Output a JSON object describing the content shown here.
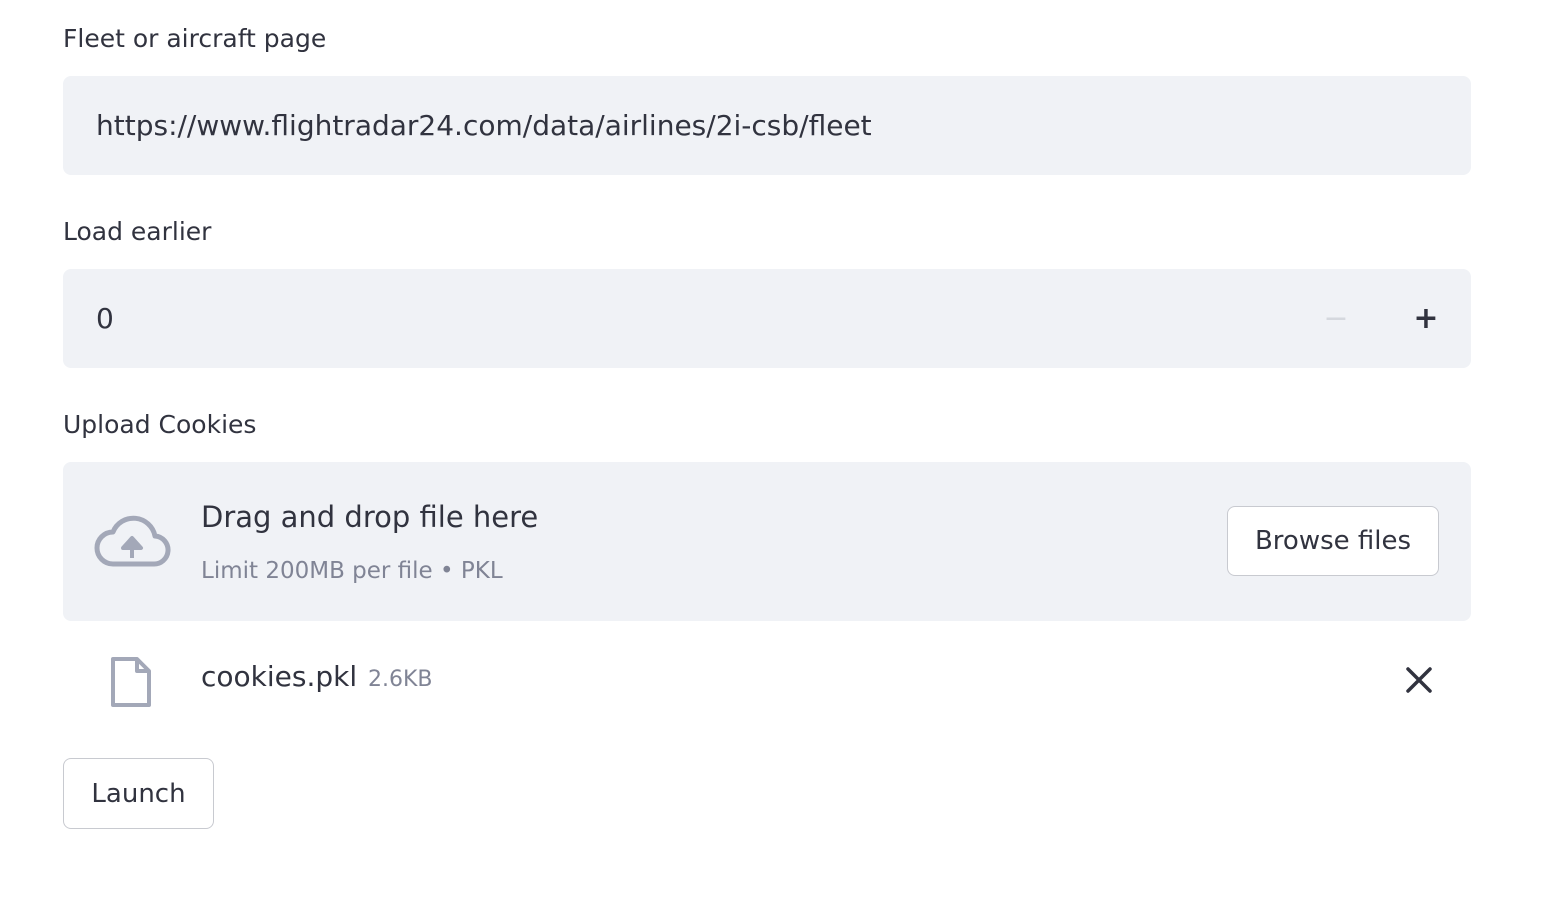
{
  "url_field": {
    "label": "Fleet or aircraft page",
    "value": "https://www.flightradar24.com/data/airlines/2i-csb/fleet"
  },
  "load_earlier": {
    "label": "Load earlier",
    "value": "0",
    "minus_symbol": "−",
    "plus_symbol": "+"
  },
  "uploader": {
    "label": "Upload Cookies",
    "title": "Drag and drop file here",
    "subtitle": "Limit 200MB per file • PKL",
    "browse_label": "Browse files",
    "icon": "cloud-upload-icon"
  },
  "uploaded_file": {
    "name": "cookies.pkl",
    "size": "2.6KB",
    "icon": "file-icon",
    "remove_icon": "close-icon"
  },
  "launch_label": "Launch",
  "colors": {
    "field_bg": "#f0f2f6",
    "text": "#31333f",
    "muted": "#808495",
    "icon": "#a3a8b8",
    "border": "#c8cad0"
  }
}
